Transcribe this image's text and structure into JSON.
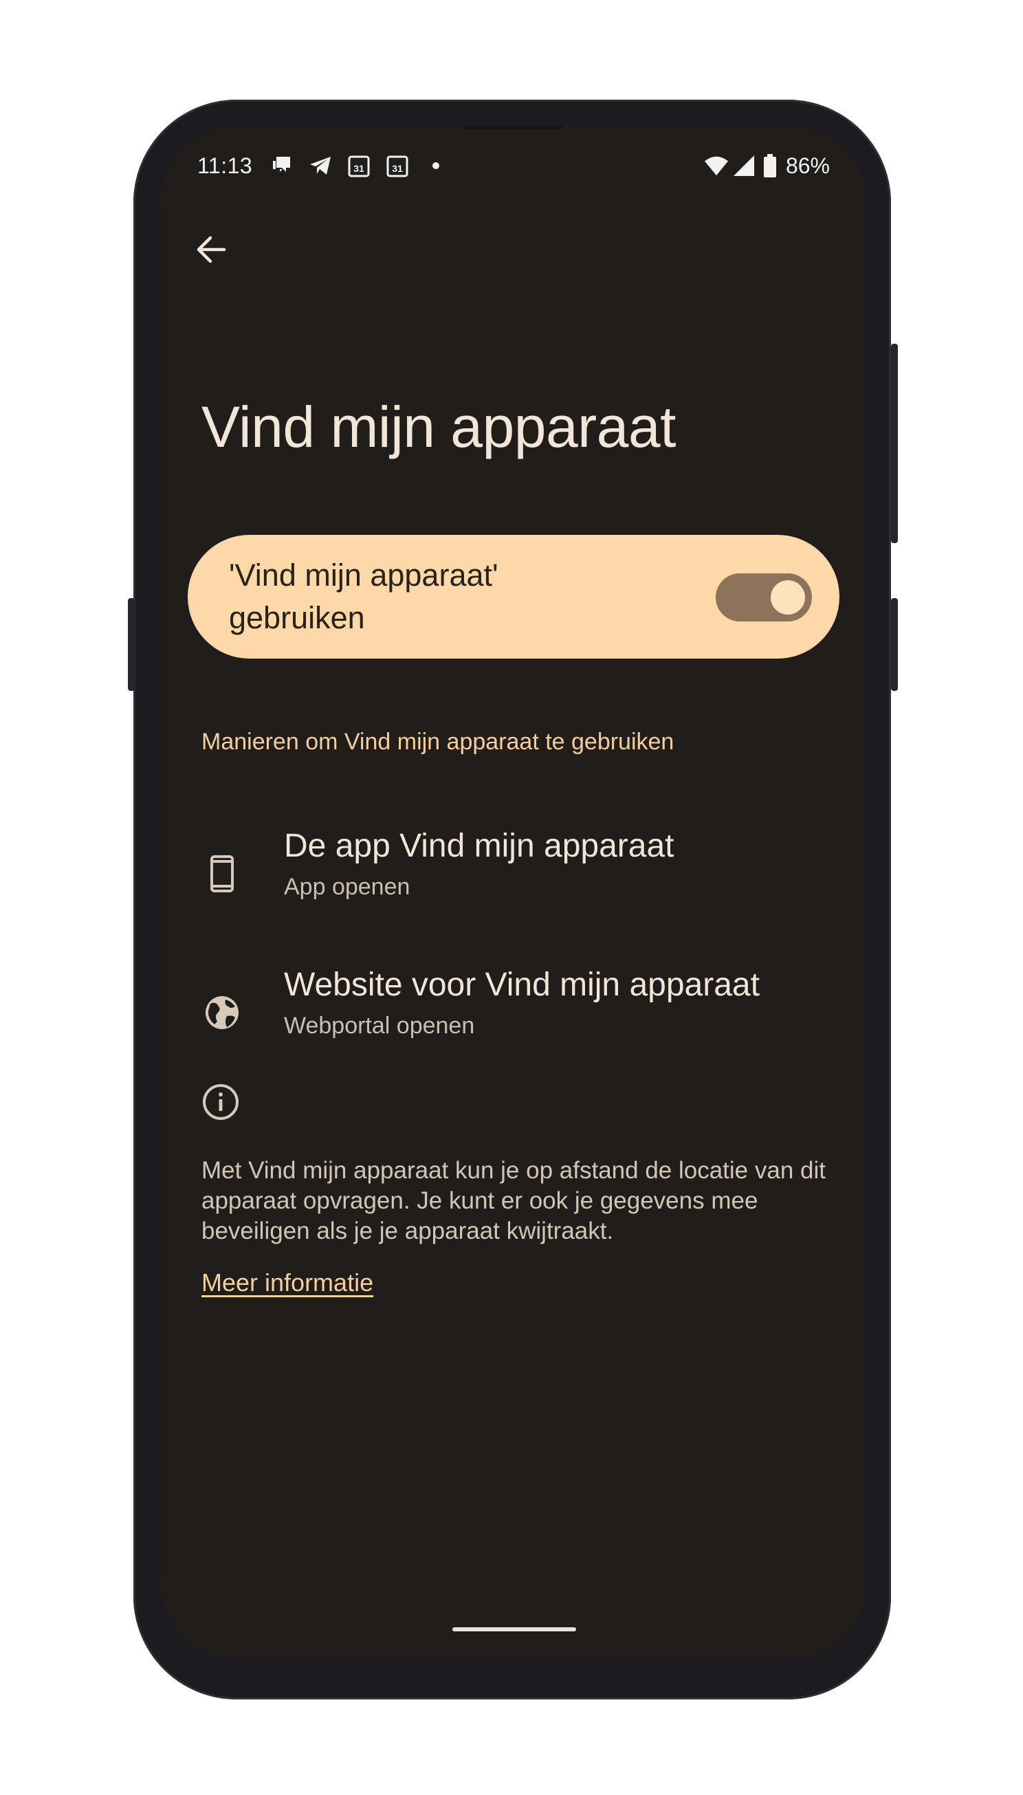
{
  "status_bar": {
    "time": "11:13",
    "calendar_day_1": "31",
    "calendar_day_2": "31",
    "battery_percent": "86%",
    "icons": [
      "chat-icon",
      "telegram-icon",
      "calendar-icon",
      "calendar-icon",
      "dot-icon",
      "wifi-icon",
      "signal-icon",
      "battery-icon"
    ]
  },
  "header": {
    "back_icon": "arrow-back-icon",
    "title": "Vind mijn apparaat"
  },
  "main_toggle": {
    "label": "'Vind mijn apparaat' gebruiken",
    "enabled": true
  },
  "section": {
    "header": "Manieren om Vind mijn apparaat te gebruiken",
    "items": [
      {
        "icon": "phone-icon",
        "title": "De app Vind mijn apparaat",
        "subtitle": "App openen"
      },
      {
        "icon": "globe-icon",
        "title": "Website voor Vind mijn apparaat",
        "subtitle": "Webportal openen"
      }
    ]
  },
  "info": {
    "icon": "info-icon",
    "text": "Met Vind mijn apparaat kun je op afstand de locatie van dit apparaat opvragen. Je kunt er ook je gegevens mee beveiligen als je je apparaat kwijtraakt.",
    "link": "Meer informatie"
  },
  "colors": {
    "background": "#201d1a",
    "accent": "#f4cf9b",
    "toggle_card": "#fdd9a9",
    "switch_track": "#8c735a"
  }
}
